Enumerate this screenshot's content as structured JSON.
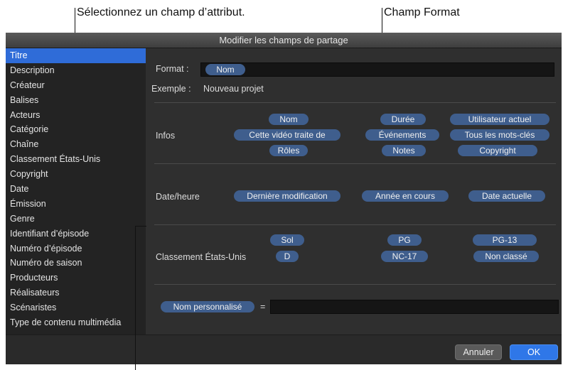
{
  "callouts": {
    "select_attribute": "Sélectionnez un champ d’attribut.",
    "format_field": "Champ Format"
  },
  "dialog": {
    "title": "Modifier les champs de partage"
  },
  "sidebar": {
    "selected_index": 0,
    "items": [
      "Titre",
      "Description",
      "Créateur",
      "Balises",
      "Acteurs",
      "Catégorie",
      "Chaîne",
      "Classement États-Unis",
      "Copyright",
      "Date",
      "Émission",
      "Genre",
      "Identifiant d’épisode",
      "Numéro d’épisode",
      "Numéro de saison",
      "Producteurs",
      "Réalisateurs",
      "Scénaristes",
      "Type de contenu multimédia"
    ]
  },
  "format": {
    "label": "Format :",
    "token": "Nom",
    "example_label": "Exemple :",
    "example_value": "Nouveau projet"
  },
  "groups": {
    "infos": {
      "label": "Infos",
      "tokens": [
        "Nom",
        "Durée",
        "Utilisateur actuel",
        "Cette vidéo traite de",
        "Événements",
        "Tous les mots-clés",
        "Rôles",
        "Notes",
        "Copyright"
      ]
    },
    "datetime": {
      "label": "Date/heure",
      "tokens": [
        "Dernière modification",
        "Année en cours",
        "Date actuelle"
      ]
    },
    "rating": {
      "label": "Classement États-Unis",
      "tokens": [
        "Sol",
        "PG",
        "PG-13",
        "D",
        "NC-17",
        "Non classé"
      ]
    }
  },
  "custom": {
    "token": "Nom personnalisé",
    "equals": "="
  },
  "buttons": {
    "cancel": "Annuler",
    "ok": "OK"
  },
  "colors": {
    "selection": "#2f6cd8",
    "token": "#3f5e8d",
    "ok_button": "#2f77e8"
  }
}
